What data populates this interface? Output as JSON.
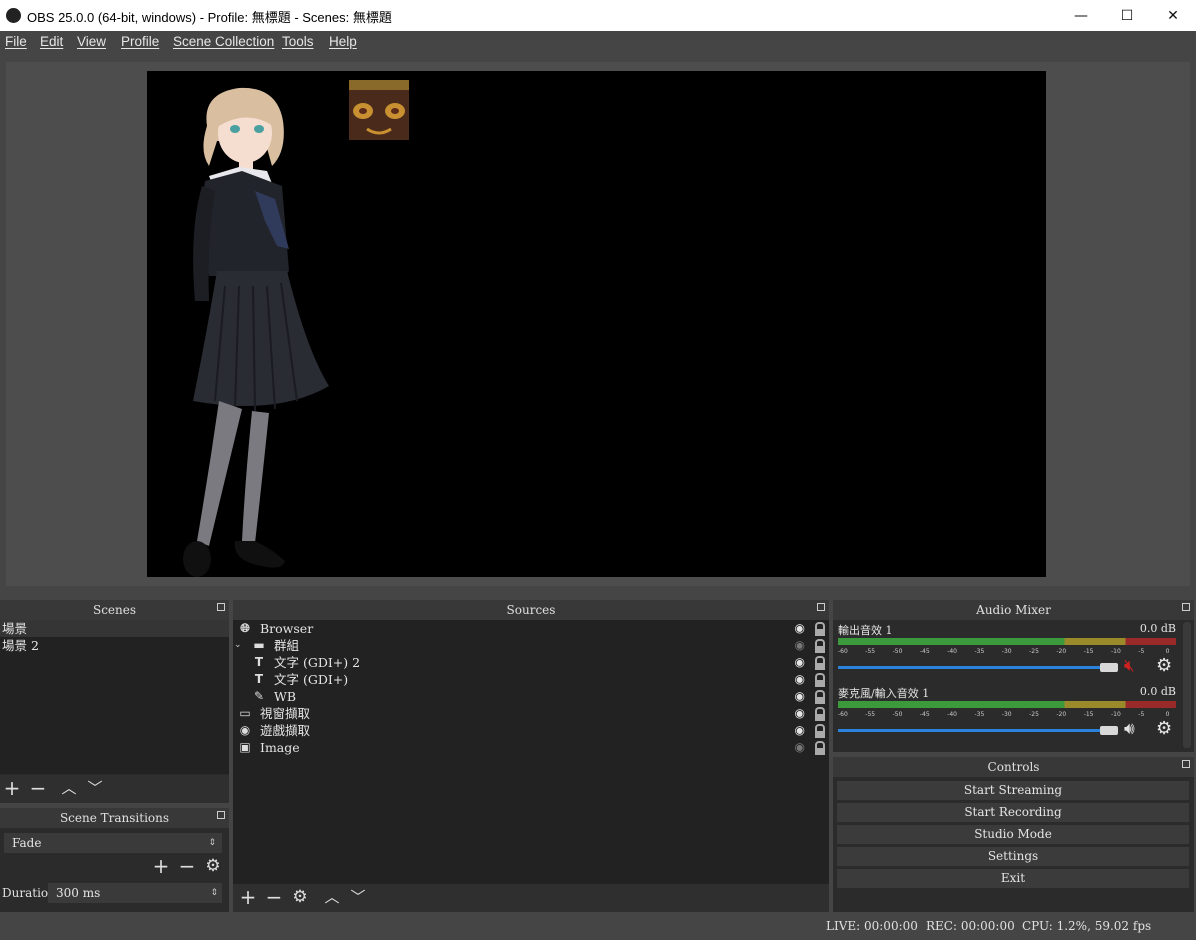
{
  "window": {
    "title": "OBS 25.0.0 (64-bit, windows) - Profile: 無標題 - Scenes: 無標題",
    "minimize": "—",
    "maximize": "☐",
    "close": "✕"
  },
  "menu": [
    "File",
    "Edit",
    "View",
    "Profile",
    "Scene Collection",
    "Tools",
    "Help"
  ],
  "docks": {
    "scenes": {
      "title": "Scenes",
      "items": [
        "場景",
        "場景 2"
      ],
      "selected_index": 0
    },
    "transitions": {
      "title": "Scene Transitions",
      "selected": "Fade",
      "duration_label": "Duration",
      "duration_value": "300 ms"
    },
    "sources": {
      "title": "Sources",
      "items": [
        {
          "name": "Browser",
          "icon": "globe-icon",
          "indent": 0,
          "visible": true
        },
        {
          "name": "群組",
          "icon": "folder-icon",
          "indent": 0,
          "visible": false,
          "expander": "chevron-down-icon"
        },
        {
          "name": "文字 (GDI+) 2",
          "icon": "text-icon",
          "indent": 1,
          "visible": true
        },
        {
          "name": "文字 (GDI+)",
          "icon": "text-icon",
          "indent": 1,
          "visible": true
        },
        {
          "name": "WB",
          "icon": "brush-icon",
          "indent": 1,
          "visible": true
        },
        {
          "name": "視窗擷取",
          "icon": "window-icon",
          "indent": 0,
          "visible": true
        },
        {
          "name": "遊戲擷取",
          "icon": "gamepad-icon",
          "indent": 0,
          "visible": true
        },
        {
          "name": "Image",
          "icon": "image-icon",
          "indent": 0,
          "visible": false
        }
      ]
    },
    "mixer": {
      "title": "Audio Mixer",
      "channels": [
        {
          "name": "輸出音效 1",
          "db": "0.0 dB",
          "muted": true,
          "volume": 1.0
        },
        {
          "name": "麥克風/輸入音效 1",
          "db": "0.0 dB",
          "muted": false,
          "volume": 1.0
        }
      ],
      "scale": [
        "-60",
        "-55",
        "-50",
        "-45",
        "-40",
        "-35",
        "-30",
        "-25",
        "-20",
        "-15",
        "-10",
        "-5",
        "0"
      ]
    },
    "controls": {
      "title": "Controls",
      "buttons": [
        "Start Streaming",
        "Start Recording",
        "Studio Mode",
        "Settings",
        "Exit"
      ]
    }
  },
  "status": {
    "live": "LIVE: 00:00:00",
    "rec": "REC: 00:00:00",
    "cpu": "CPU: 1.2%, 59.02 fps"
  },
  "colors": {
    "accent": "#2a82da",
    "meter_green": "#3c9a3c",
    "meter_yellow": "#9a8a2a",
    "meter_red": "#9a2a2a",
    "muted_red": "#d32020"
  }
}
